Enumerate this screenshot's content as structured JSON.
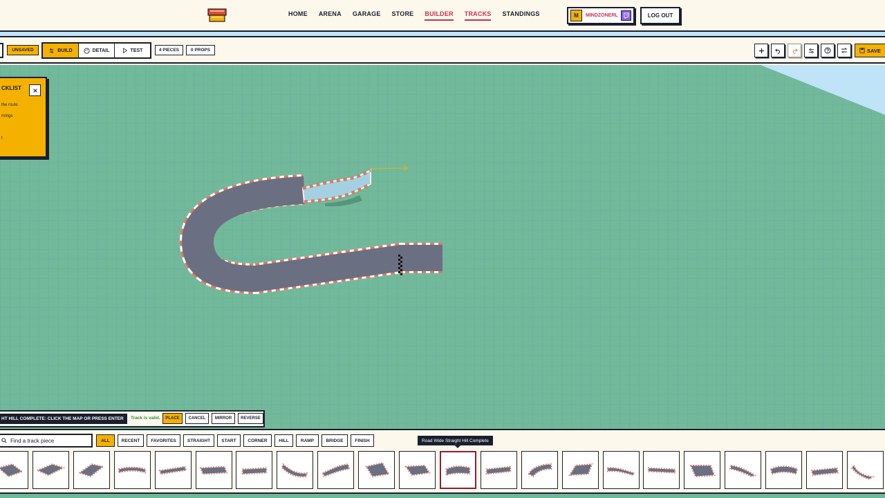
{
  "nav": {
    "links": [
      "HOME",
      "ARENA",
      "GARAGE",
      "STORE",
      "BUILDER",
      "TRACKS",
      "STANDINGS"
    ],
    "active": [
      "BUILDER",
      "TRACKS"
    ],
    "user": {
      "initial": "M",
      "name": "MINDZONERL"
    },
    "logout_label": "LOG OUT"
  },
  "toolbar": {
    "status": "UNSAVED",
    "modes": [
      "BUILD",
      "DETAIL",
      "TEST"
    ],
    "active_mode": "BUILD",
    "pieces_count": "4 PIECES",
    "props_count": "0 PROPS",
    "save_label": "SAVE"
  },
  "checklist": {
    "title": "CKLIST",
    "items": [
      "the route",
      "rnings",
      "",
      "t"
    ]
  },
  "placement": {
    "message": "HT HILL COMPLETE: CLICK THE MAP OR PRESS ENTER",
    "valid": "Track is valid.",
    "buttons": [
      "PLACE",
      "CANCEL",
      "MIRROR",
      "REVERSE"
    ]
  },
  "pieces": {
    "search_placeholder": "Find a track piece",
    "filters": [
      "ALL",
      "RECENT",
      "FAVORITES",
      "STRAIGHT",
      "START",
      "CORNER",
      "HILL",
      "RAMP",
      "BRIDGE",
      "FINISH"
    ],
    "active_filter": "ALL",
    "tooltip": "Road Wide Straight Hill Complete",
    "selected_index": 11,
    "tile_count": 22
  },
  "colors": {
    "accent": "#f5b100",
    "brand": "#c72f52",
    "ink": "#1a1f2e",
    "ground": "#6fb89c",
    "sky": "#bfe3f7"
  }
}
